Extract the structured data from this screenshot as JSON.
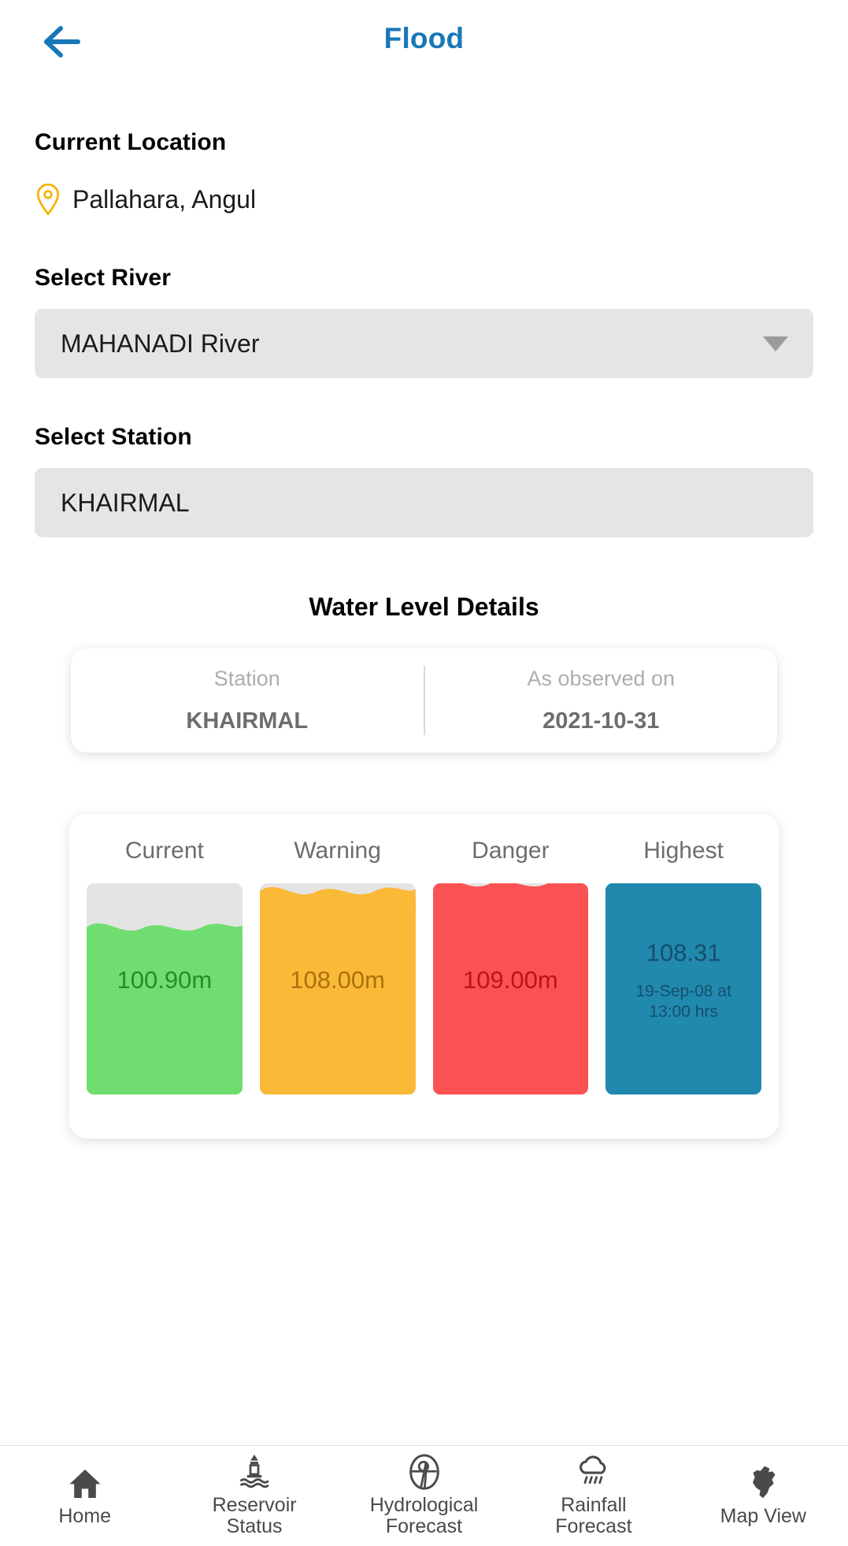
{
  "header": {
    "back_icon": "arrow-left-icon",
    "title": "Flood",
    "title_color": "#1877b8"
  },
  "location": {
    "heading": "Current Location",
    "pin_icon": "location-pin-icon",
    "pin_color": "#f2b705",
    "value": "Pallahara, Angul"
  },
  "river": {
    "label": "Select River",
    "selected": "MAHANADI River",
    "caret_icon": "chevron-down-icon"
  },
  "station": {
    "label": "Select Station",
    "selected": "KHAIRMAL"
  },
  "water_level": {
    "title": "Water Level Details",
    "station_label": "Station",
    "station_value": "KHAIRMAL",
    "observed_label": "As observed on",
    "observed_value": "2021-10-31"
  },
  "chart_data": {
    "type": "bar",
    "title": "Water Level Details",
    "categories": [
      "Current",
      "Warning",
      "Danger",
      "Highest"
    ],
    "values": [
      100.9,
      108.0,
      109.0,
      108.31
    ],
    "unit": "m",
    "value_labels": [
      "100.90m",
      "108.00m",
      "109.00m",
      "108.31"
    ],
    "annotations": [
      "",
      "",
      "",
      "19-Sep-08 at\n13:00 hrs"
    ],
    "fill_percents": [
      75,
      92,
      96,
      100
    ],
    "colors": [
      "#6fdd6f",
      "#fbb938",
      "#fa5252",
      "#2188ae"
    ],
    "text_colors": [
      "#239023",
      "#a9730a",
      "#bb1414",
      "#14506b"
    ],
    "wave_colors": [
      "rgba(255,255,255,0.35)",
      "rgba(122,96,45,0.45)",
      "rgba(255,255,255,0.55)",
      "rgba(180,220,235,0.75)"
    ],
    "track_color": "#e4e4e4",
    "xlabel": "",
    "ylabel": ""
  },
  "bottom_nav": {
    "items": [
      {
        "label": "Home",
        "icon": "home-icon"
      },
      {
        "label": "Reservoir\nStatus",
        "icon": "reservoir-buoy-icon"
      },
      {
        "label": "Hydrological\nForecast",
        "icon": "hydrological-gauge-icon"
      },
      {
        "label": "Rainfall\nForecast",
        "icon": "rain-cloud-icon"
      },
      {
        "label": "Map View",
        "icon": "map-region-icon"
      }
    ]
  }
}
